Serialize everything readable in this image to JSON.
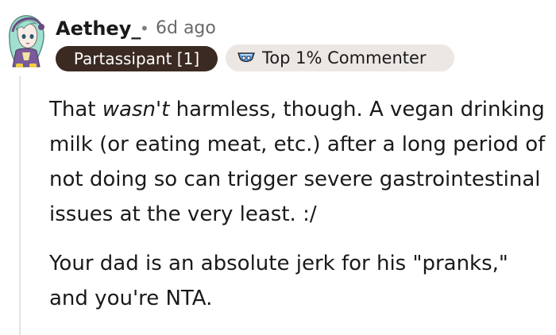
{
  "comment": {
    "username": "Aethey_",
    "separator": "•",
    "timestamp": "6d ago",
    "flair": "Partassipant [1]",
    "badge": {
      "icon": "top-commenter-icon",
      "label": "Top 1% Commenter"
    },
    "paragraph1": {
      "before": "That ",
      "emphasis": "wasn't",
      "after": " harmless, though. A vegan drinking milk (or eating meat, etc.) after a long period of not doing so can trigger severe gastrointestinal issues at the very least. :/"
    },
    "paragraph2": "Your dad is an absolute jerk for his \"pranks,\" and you're NTA."
  },
  "colors": {
    "flair_bg": "#3b2a22",
    "badge_bg": "#ece7e3",
    "thread_line": "#e3e3e3"
  }
}
